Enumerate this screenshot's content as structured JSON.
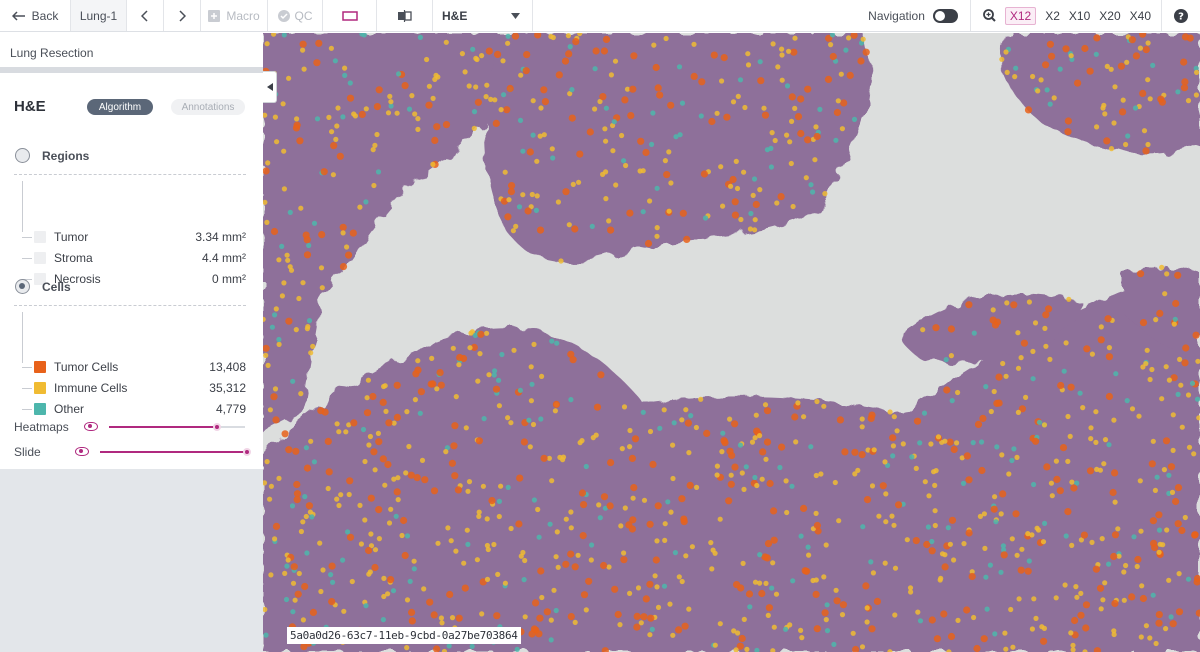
{
  "toolbar": {
    "back_label": "Back",
    "case_name": "Lung-1",
    "macro_label": "Macro",
    "qc_label": "QC",
    "stain_select": "H&E",
    "navigation_label": "Navigation",
    "zoom_options": [
      "X12",
      "X2",
      "X10",
      "X20",
      "X40"
    ],
    "zoom_selected": "X12"
  },
  "sidebar": {
    "project_name": "Lung Resection",
    "stain_header": "H&E",
    "tabs": {
      "algorithm": "Algorithm",
      "annotations": "Annotations"
    },
    "regions": {
      "title": "Regions",
      "items": [
        {
          "label": "Tumor",
          "value": "3.34 mm²",
          "color": "#eeeff1"
        },
        {
          "label": "Stroma",
          "value": "4.4 mm²",
          "color": "#eeeff1"
        },
        {
          "label": "Necrosis",
          "value": "0 mm²",
          "color": "#eeeff1"
        }
      ]
    },
    "cells": {
      "title": "Cells",
      "items": [
        {
          "label": "Tumor Cells",
          "value": "13,408",
          "color": "#e8621a"
        },
        {
          "label": "Immune Cells",
          "value": "35,312",
          "color": "#f0bb32"
        },
        {
          "label": "Other",
          "value": "4,779",
          "color": "#4db6ac"
        }
      ]
    },
    "layers": [
      {
        "label": "Heatmaps",
        "level": 0.8
      },
      {
        "label": "Slide",
        "level": 1.0
      }
    ]
  },
  "viewer": {
    "slide_id": "5a0a0d26-63c7-11eb-9cbd-0a27be703864"
  },
  "colors": {
    "accent": "#b0297f",
    "tissue": "#8e6f9a",
    "tumor_cell": "#e8621a",
    "immune_cell": "#f0bb32",
    "other_cell": "#4db6ac",
    "background": "#dcdedd"
  }
}
